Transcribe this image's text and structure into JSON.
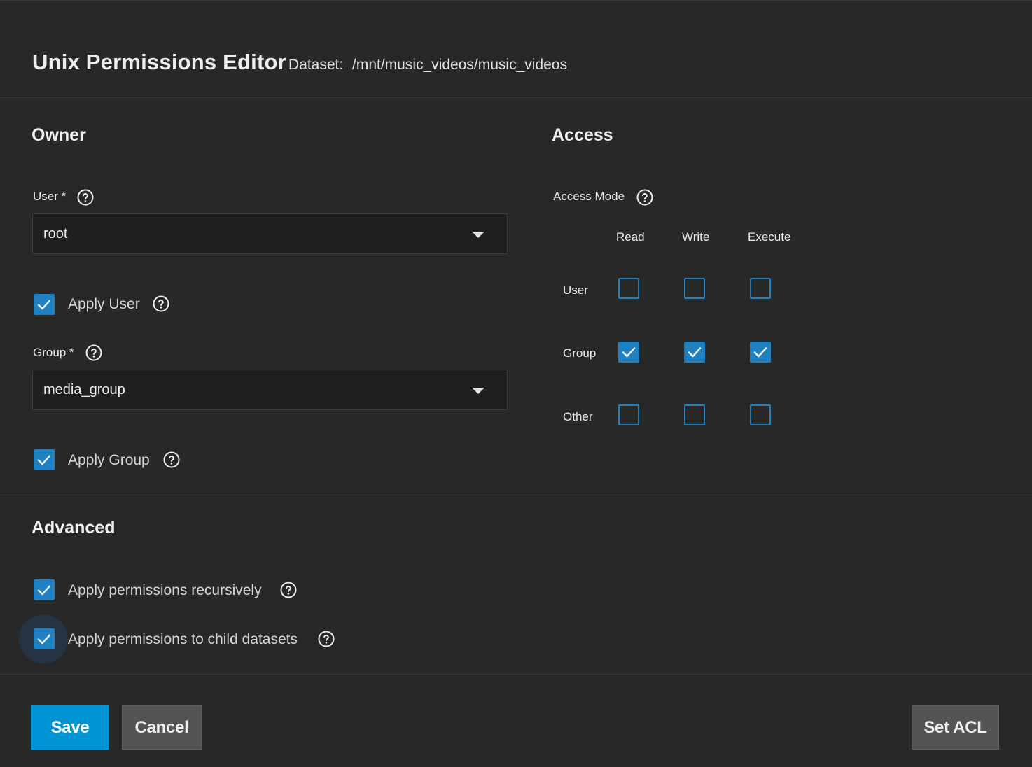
{
  "header": {
    "title": "Unix Permissions Editor",
    "dataset_label": "Dataset:",
    "dataset_path": "/mnt/music_videos/music_videos"
  },
  "owner": {
    "title": "Owner",
    "user_label": "User *",
    "user_value": "root",
    "apply_user_label": "Apply User",
    "apply_user_checked": true,
    "group_label": "Group *",
    "group_value": "media_group",
    "apply_group_label": "Apply Group",
    "apply_group_checked": true
  },
  "access": {
    "title": "Access",
    "mode_label": "Access Mode",
    "columns": [
      "Read",
      "Write",
      "Execute"
    ],
    "rows": [
      {
        "label": "User",
        "read": false,
        "write": false,
        "execute": false
      },
      {
        "label": "Group",
        "read": true,
        "write": true,
        "execute": true
      },
      {
        "label": "Other",
        "read": false,
        "write": false,
        "execute": false
      }
    ]
  },
  "advanced": {
    "title": "Advanced",
    "recursive_label": "Apply permissions recursively",
    "recursive_checked": true,
    "child_label": "Apply permissions to child datasets",
    "child_checked": true
  },
  "actions": {
    "save": "Save",
    "cancel": "Cancel",
    "set_acl": "Set ACL"
  },
  "colors": {
    "background": "#282828",
    "accent": "#1f80c2",
    "primary_button": "#0095d5",
    "secondary_button": "#545454"
  },
  "icons": {
    "help": "help-circle-icon",
    "check": "checkmark-icon",
    "dropdown": "caret-down-icon"
  }
}
